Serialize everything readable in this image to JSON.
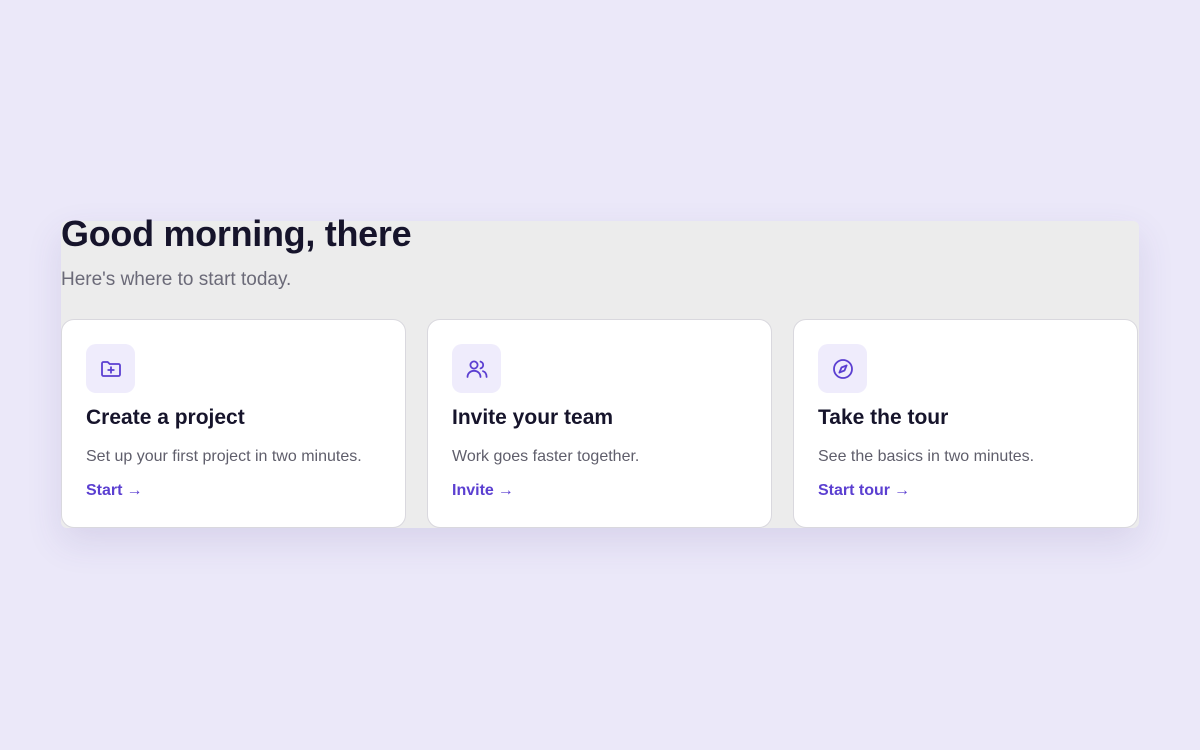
{
  "header": {
    "greeting": "Good morning, there",
    "subtitle": "Here's where to start today."
  },
  "theme": {
    "background": "#ebe8f9",
    "panel": "#ececec",
    "accent": "#5b3fd1",
    "icon_tile": "#efecfc",
    "title_text": "#16142b",
    "muted_text": "#6b6a78"
  },
  "cards": [
    {
      "icon": "folder-plus-icon",
      "title": "Create a project",
      "description": "Set up your first project in two minutes.",
      "action_label": "Start",
      "arrow": "→"
    },
    {
      "icon": "users-icon",
      "title": "Invite your team",
      "description": "Work goes faster together.",
      "action_label": "Invite",
      "arrow": "→"
    },
    {
      "icon": "compass-icon",
      "title": "Take the tour",
      "description": "See the basics in two minutes.",
      "action_label": "Start tour",
      "arrow": "→"
    }
  ]
}
